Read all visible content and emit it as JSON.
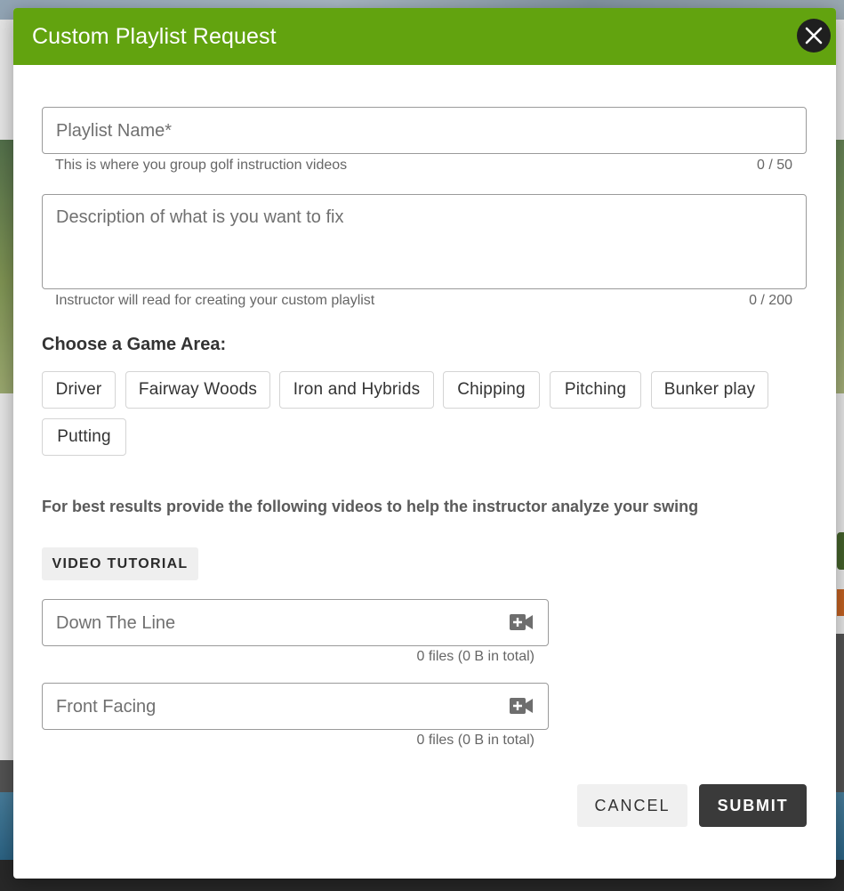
{
  "modal": {
    "title": "Custom Playlist Request",
    "close_icon": "close-icon"
  },
  "form": {
    "playlist_name": {
      "placeholder": "Playlist Name*",
      "value": "",
      "hint": "This is where you group golf instruction videos",
      "counter": "0 / 50"
    },
    "description": {
      "placeholder": "Description of what is you want to fix",
      "value": "",
      "hint": "Instructor will read for creating your custom playlist",
      "counter": "0 / 200"
    },
    "game_area": {
      "label": "Choose a Game Area:",
      "options": [
        "Driver",
        "Fairway Woods",
        "Iron and Hybrids",
        "Chipping",
        "Pitching",
        "Bunker play",
        "Putting"
      ]
    },
    "advice": "For best results provide the following videos to help the instructor analyze your swing",
    "tutorial_button": "VIDEO TUTORIAL",
    "uploads": [
      {
        "label": "Down The Line",
        "icon": "video-plus-icon",
        "file_count": "0 files (0 B in total)"
      },
      {
        "label": "Front Facing",
        "icon": "video-plus-icon",
        "file_count": "0 files (0 B in total)"
      }
    ]
  },
  "actions": {
    "cancel": "CANCEL",
    "submit": "SUBMIT"
  },
  "colors": {
    "header_green": "#62a30f",
    "submit_dark": "#3a3a3a",
    "close_dark": "#1f1f1f"
  }
}
